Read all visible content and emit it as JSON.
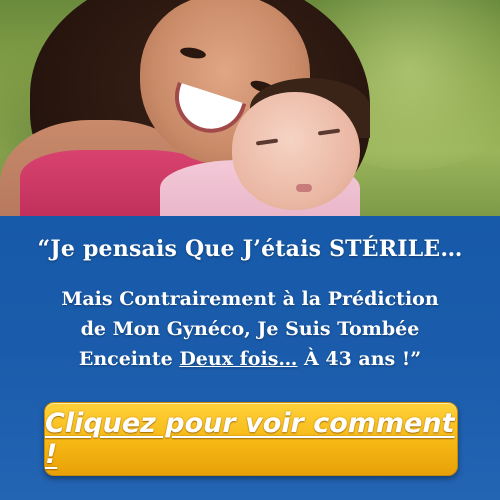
{
  "ad": {
    "headline": "“Je pensais Que J’étais STÉRILE…",
    "subline": {
      "line1": "Mais Contrairement à la Prédiction",
      "line2": "de Mon Gynéco, Je Suis Tombée",
      "line3_prefix": "Enceinte ",
      "line3_underlined": "Deux fois…",
      "line3_suffix": " À 43 ans !”"
    },
    "cta_label": "Cliquez pour voir comment !",
    "colors": {
      "panel_blue": "#175aa9",
      "cta_yellow": "#f6b714",
      "text": "#ffffff"
    }
  }
}
